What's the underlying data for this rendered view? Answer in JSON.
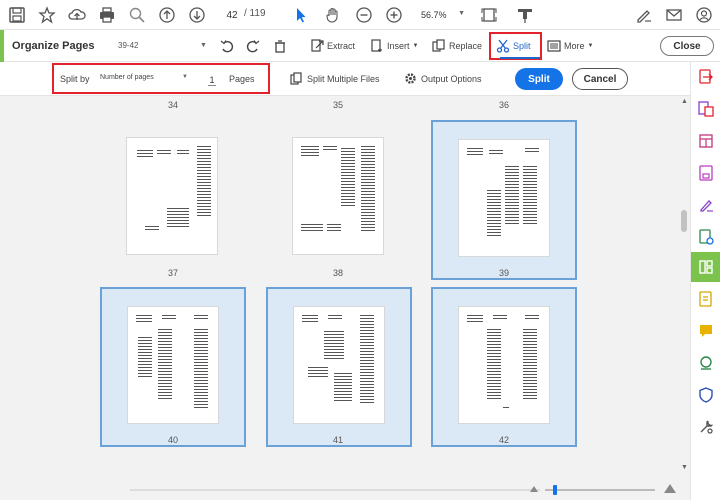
{
  "toolbar": {
    "page_current": "42",
    "page_total": "/ 119",
    "zoom": "56.7%"
  },
  "organize": {
    "title": "Organize Pages",
    "range": "39-42",
    "extract_label": "Extract",
    "insert_label": "Insert",
    "replace_label": "Replace",
    "split_label": "Split",
    "more_label": "More",
    "close_label": "Close"
  },
  "split_options": {
    "split_by_label": "Split by",
    "split_by_value": "Number of pages",
    "pages_value": "1",
    "pages_label": "Pages",
    "split_multiple_label": "Split Multiple Files",
    "output_options_label": "Output Options",
    "split_button_label": "Split",
    "cancel_button_label": "Cancel"
  },
  "pages": {
    "top_labels": [
      "34",
      "35",
      "36"
    ],
    "row1": [
      "37",
      "38",
      "39"
    ],
    "row2": [
      "40",
      "41",
      "42"
    ],
    "selected": [
      "39",
      "40",
      "41",
      "42"
    ]
  },
  "colors": {
    "accent_blue": "#1473e6",
    "highlight_red": "#e2232b",
    "tool_green": "#7cc34d",
    "selection_fill": "#dbe9f7"
  }
}
